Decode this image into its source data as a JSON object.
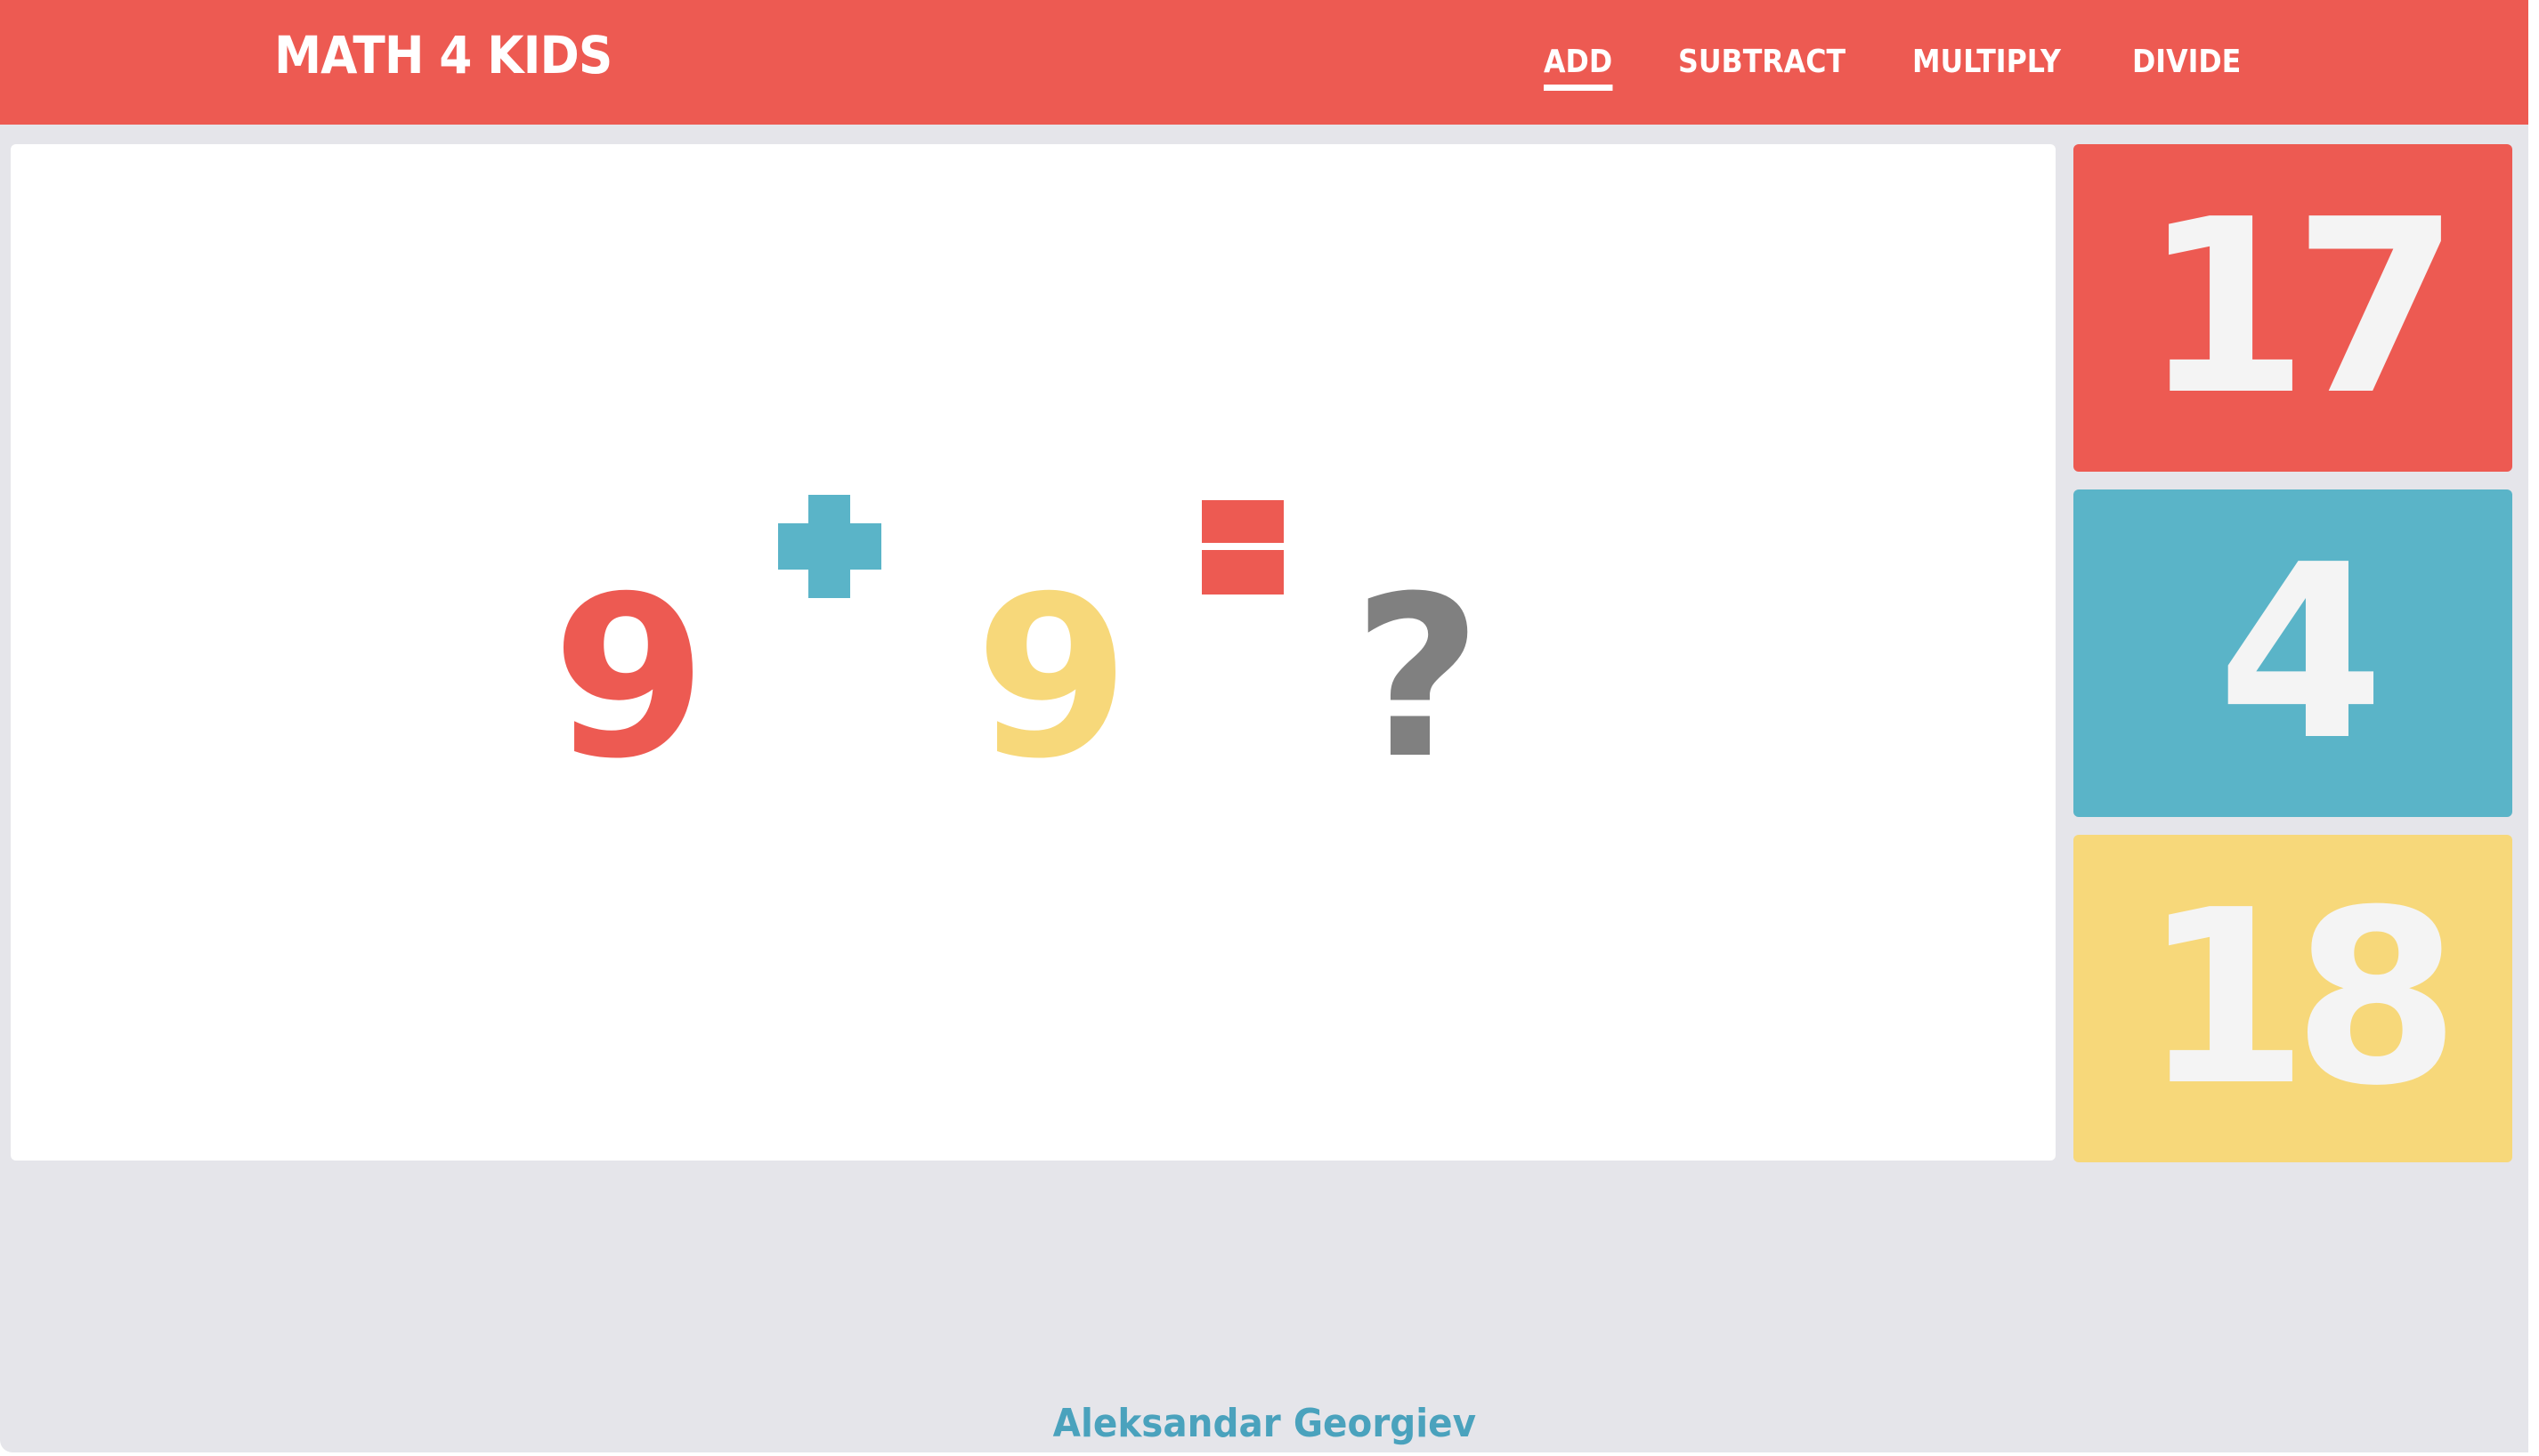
{
  "header": {
    "brand": "Math 4 Kids",
    "background_color": "#ed5a52",
    "nav": [
      {
        "label": "Add",
        "active": true
      },
      {
        "label": "Subtract",
        "active": false
      },
      {
        "label": "Multiply",
        "active": false
      },
      {
        "label": "Divide",
        "active": false
      }
    ]
  },
  "problem": {
    "left_operand": "9",
    "operator": "+",
    "operator_icon": "plus-icon",
    "right_operand": "9",
    "equals_icon": "equals-icon",
    "unknown": "?",
    "colors": {
      "left_operand": "#ed5a52",
      "operator": "#5ab4c8",
      "right_operand": "#f7d87a",
      "equals": "#ed5a52",
      "unknown": "#808080"
    }
  },
  "answers": [
    {
      "value": "17",
      "color": "#ed5a52"
    },
    {
      "value": "4",
      "color": "#5ab4c8"
    },
    {
      "value": "18",
      "color": "#f7d87a"
    }
  ],
  "footer": {
    "author_link": "Aleksandar Georgiev",
    "link_color": "#4aa2bd"
  }
}
